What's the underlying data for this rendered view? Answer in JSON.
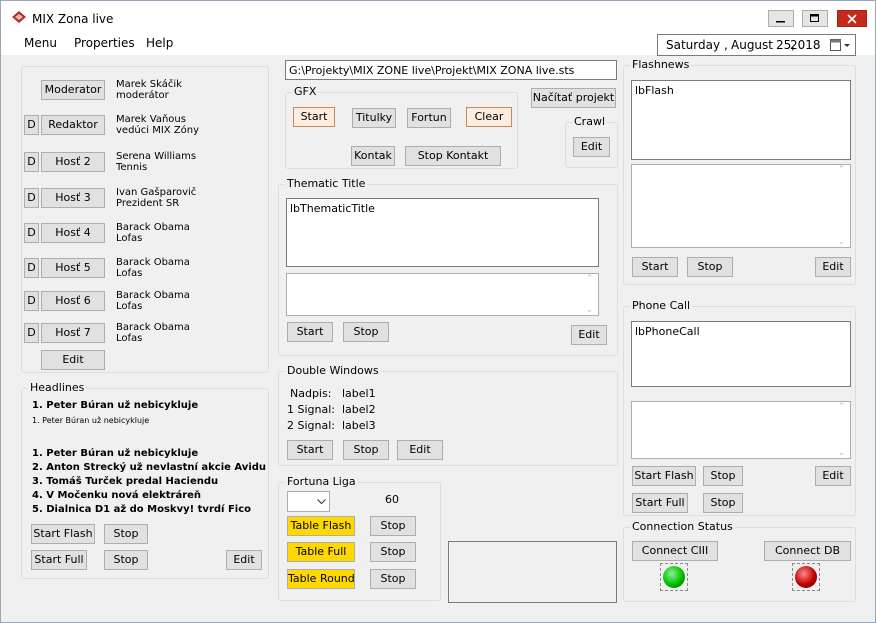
{
  "window": {
    "title": "MIX Zona live",
    "minimize": "–",
    "maximize": "□",
    "close": "✕"
  },
  "menu": [
    "Menu",
    "Properties",
    "Help"
  ],
  "date": {
    "day": "Saturday",
    "sep1": ",",
    "month": "August",
    "daynum": "25,",
    "year": "2018"
  },
  "guests": [
    {
      "d": "",
      "button": "Moderator",
      "line1": "Marek Skáčik",
      "line2": "moderátor"
    },
    {
      "d": "D",
      "button": "Redaktor",
      "line1": "Marek Vaňous",
      "line2": "vedúci MIX Zóny"
    },
    {
      "d": "D",
      "button": "Hosť 2",
      "line1": "Serena Williams",
      "line2": "Tennis"
    },
    {
      "d": "D",
      "button": "Hosť 3",
      "line1": "Ivan Gašparovič",
      "line2": "Prezident SR"
    },
    {
      "d": "D",
      "button": "Hosť 4",
      "line1": "Barack Obama",
      "line2": "Lofas"
    },
    {
      "d": "D",
      "button": "Hosť 5",
      "line1": "Barack Obama",
      "line2": "Lofas"
    },
    {
      "d": "D",
      "button": "Hosť 6",
      "line1": "Barack Obama",
      "line2": "Lofas"
    },
    {
      "d": "D",
      "button": "Hosť 7",
      "line1": "Barack Obama",
      "line2": "Lofas"
    }
  ],
  "guests_edit": "Edit",
  "headlines": {
    "label": "Headlines",
    "current_bold": "1. Peter Búran už nebicykluje",
    "current_small": "1. Peter Búran už nebicykluje",
    "items": [
      "1. Peter Búran už nebicykluje",
      "2. Anton Strecký už nevlastní akcie Avidu",
      "3. Tomáš Turček predal Haciendu",
      "4. V Močenku nová elektráreň",
      "5. Dialnica D1 až do Moskvy! tvrdí Fico"
    ],
    "start_flash": "Start Flash",
    "stop1": "Stop",
    "start_full": "Start Full",
    "stop2": "Stop",
    "edit": "Edit"
  },
  "path": "G:\\Projekty\\MIX ZONE live\\Projekt\\MIX ZONA live.sts",
  "load_project": "Načítať projekt",
  "gfx": {
    "label": "GFX",
    "start": "Start",
    "titulky": "Titulky",
    "fortun": "Fortun",
    "clear": "Clear",
    "kontak": "Kontak",
    "stop_kontakt": "Stop Kontakt"
  },
  "crawl": {
    "label": "Crawl",
    "edit": "Edit"
  },
  "thematic": {
    "label": "Thematic Title",
    "text": "lbThematicTitle",
    "start": "Start",
    "stop": "Stop",
    "edit": "Edit"
  },
  "double": {
    "label": "Double Windows",
    "nadpis_key": "Nadpis:",
    "nadpis_val": "label1",
    "s1_key": "1 Signal:",
    "s1_val": "label2",
    "s2_key": "2 Signal:",
    "s2_val": "label3",
    "start": "Start",
    "stop": "Stop",
    "edit": "Edit"
  },
  "fortuna": {
    "label": "Fortuna Liga",
    "number": "60",
    "table_flash": "Table Flash",
    "table_full": "Table Full",
    "table_round": "Table Round",
    "stop": "Stop"
  },
  "flashnews": {
    "label": "Flashnews",
    "text": "lbFlash",
    "start": "Start",
    "stop": "Stop",
    "edit": "Edit"
  },
  "phone": {
    "label": "Phone Call",
    "text": "lbPhoneCall",
    "start_flash": "Start Flash",
    "stop1": "Stop",
    "start_full": "Start Full",
    "stop2": "Stop",
    "edit": "Edit"
  },
  "conn": {
    "label": "Connection Status",
    "ciii": "Connect CIII",
    "db": "Connect DB"
  },
  "colors": {
    "yellow": "#ffd800",
    "green": "#00c000",
    "red": "#c00000"
  }
}
